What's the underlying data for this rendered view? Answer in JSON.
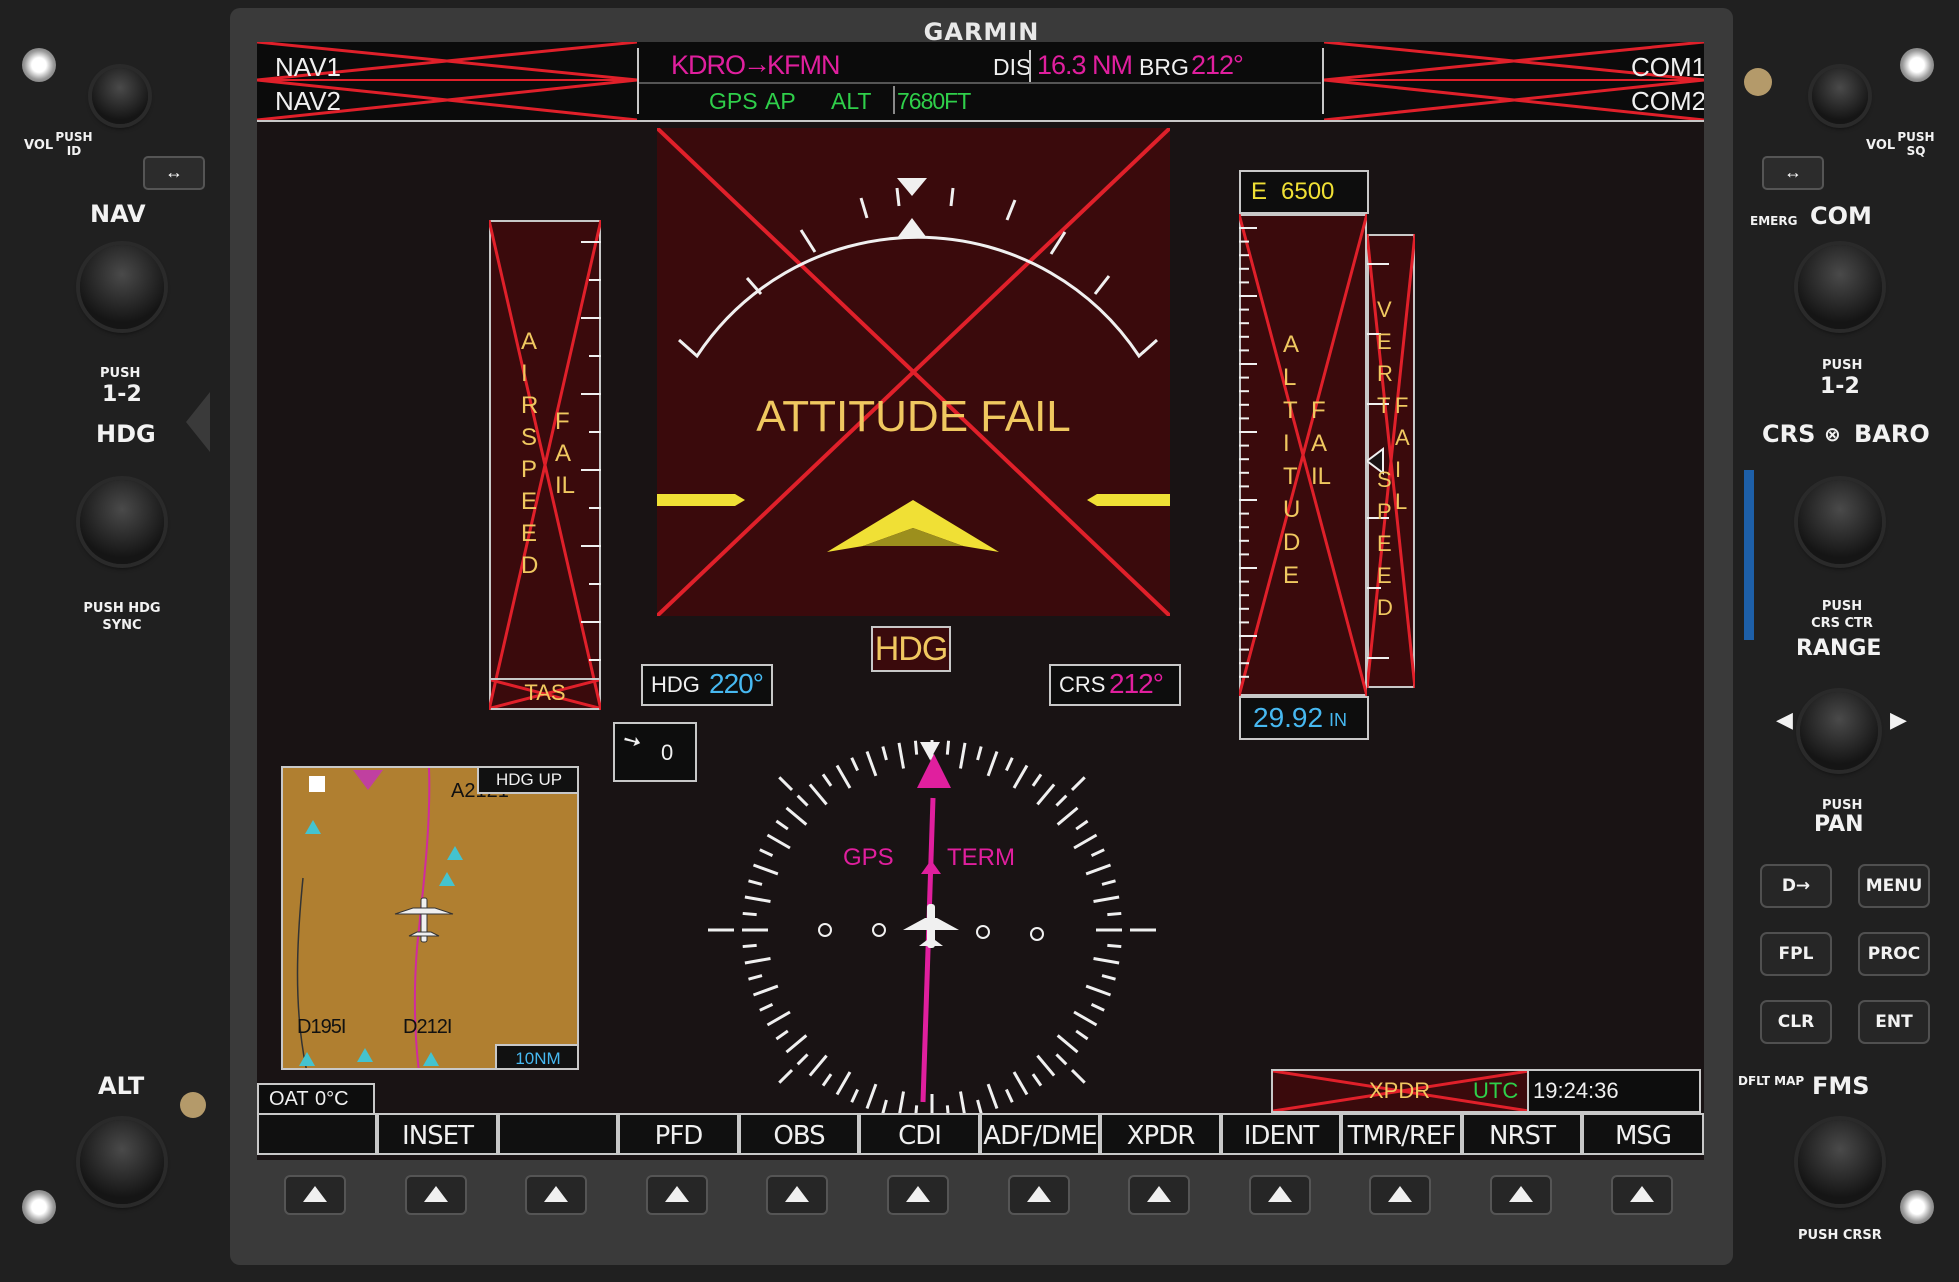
{
  "brand": "GARMIN",
  "top_bar": {
    "nav1": "NAV1",
    "nav2": "NAV2",
    "com1": "COM1",
    "com2": "COM2",
    "waypoint_from": "KDRO",
    "waypoint_to": "KFMN",
    "dis_label": "DIS",
    "dis_value": "16.3 NM",
    "brg_label": "BRG",
    "brg_value": "212°",
    "ap_mode_1": "GPS",
    "ap_mode_2": "AP",
    "ap_mode_3": "ALT",
    "alt_select": "7680FT"
  },
  "pfd": {
    "attitude_fail": "ATTITUDE FAIL",
    "airspeed_fail_word1": "AIRSPEED",
    "airspeed_fail_word2": "FAIL",
    "tas_label": "TAS",
    "altitude_fail_word1": "ALTITUDE",
    "altitude_fail_word2": "FAIL",
    "vspeed_fail_word1": "VERT",
    "vspeed_fail_word2": "SPEED",
    "vspeed_fail_word3": "FAIL",
    "selected_alt_prefix": "E",
    "selected_alt": "6500",
    "baro_value": "29.92",
    "baro_unit": "IN",
    "hdg_flag": "HDG",
    "hdg_label": "HDG",
    "hdg_value": "220°",
    "crs_label": "CRS",
    "crs_value": "212°",
    "wind_value": "0",
    "hsi_source": "GPS",
    "hsi_mode": "TERM"
  },
  "inset_map": {
    "orientation": "HDG UP",
    "airway_label": "A2121",
    "label_1": "D195I",
    "label_2": "D212I",
    "range": "10NM"
  },
  "status": {
    "oat_label": "OAT",
    "oat_value": "0°C",
    "xpdr_label": "XPDR",
    "utc_label": "UTC",
    "utc_time": "19:24:36"
  },
  "softkeys": [
    "",
    "INSET",
    "",
    "PFD",
    "OBS",
    "CDI",
    "ADF/DME",
    "XPDR",
    "IDENT",
    "TMR/REF",
    "NRST",
    "MSG"
  ],
  "left_panel": {
    "vol_label": "VOL",
    "push_id": "PUSH ID",
    "nav_label": "NAV",
    "push_12": "PUSH",
    "one_two": "1-2",
    "hdg_label": "HDG",
    "push_hdg_sync": "PUSH HDG SYNC",
    "alt_label": "ALT"
  },
  "right_panel": {
    "vol_label": "VOL",
    "push_sq": "PUSH SQ",
    "emerg": "EMERG",
    "com_label": "COM",
    "push_12": "PUSH",
    "one_two": "1-2",
    "crs_baro": "CRS",
    "baro": "BARO",
    "push_crs_ctr": "PUSH CRS CTR",
    "range_label": "RANGE",
    "push_pan": "PUSH",
    "pan": "PAN",
    "direct_to": "D→",
    "menu": "MENU",
    "fpl": "FPL",
    "proc": "PROC",
    "clr": "CLR",
    "ent": "ENT",
    "dflt_map": "DFLT MAP",
    "fms_label": "FMS",
    "push_crsr": "PUSH CRSR"
  },
  "colors": {
    "magenta": "#e01f9e",
    "green": "#2fcf4a",
    "cyan": "#47b8f0",
    "fail_red": "#e0202a",
    "fail_bg": "#3a0a0c"
  }
}
